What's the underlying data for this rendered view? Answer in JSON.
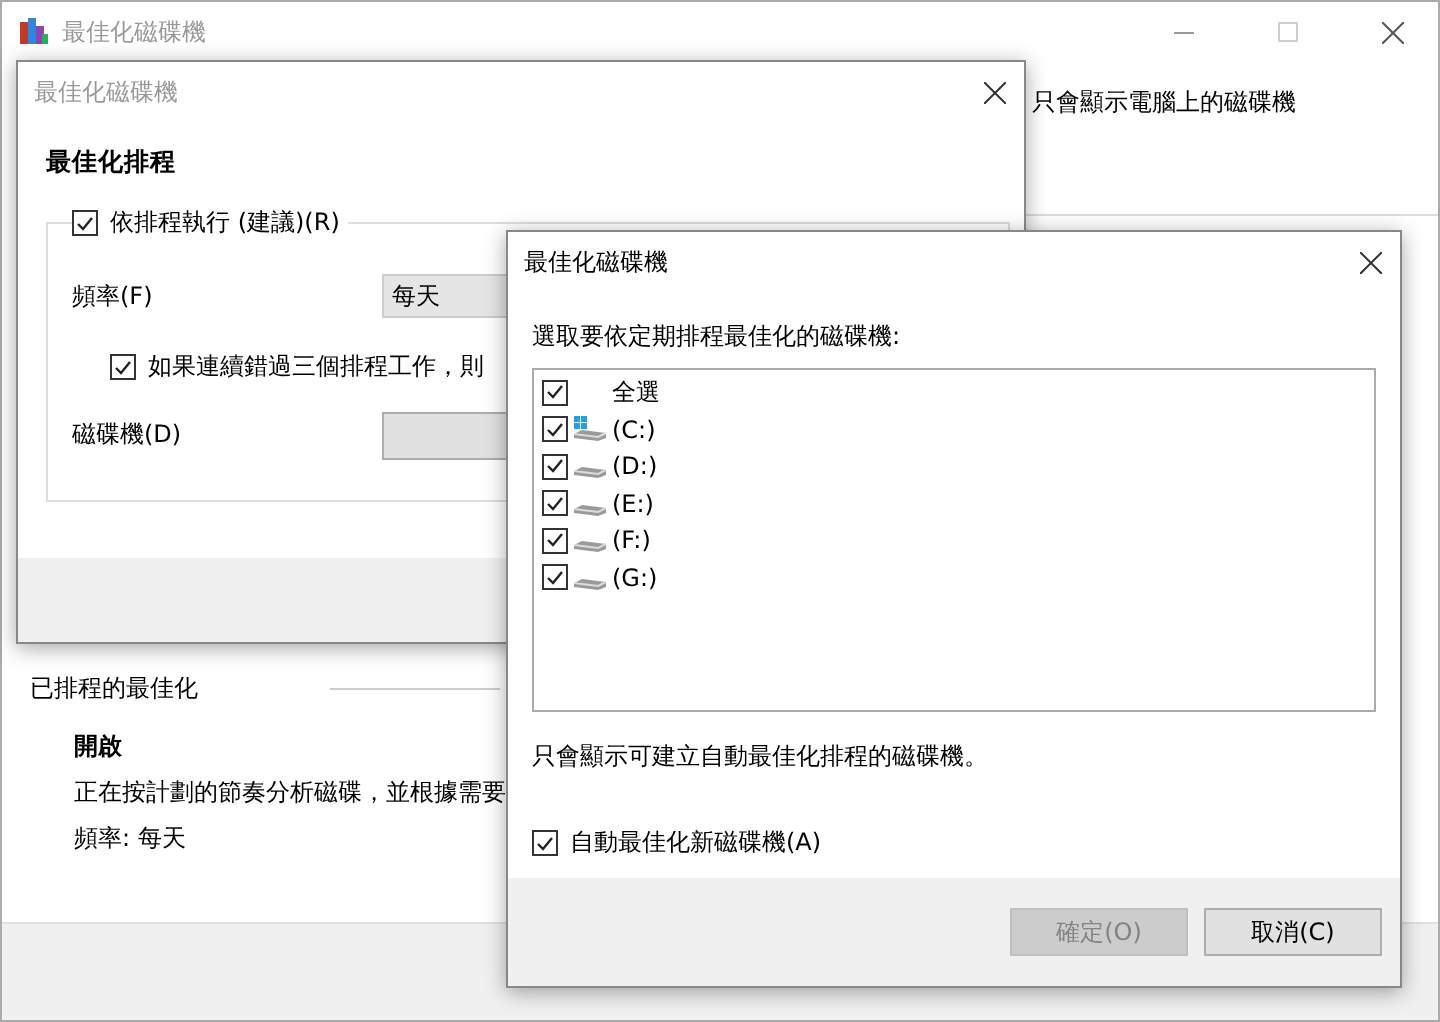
{
  "main_window": {
    "title": "最佳化磁碟機",
    "intro_text": "只會顯示電腦上的磁碟機",
    "scheduled": {
      "heading": "已排程的最佳化",
      "status": "開啟",
      "description": "正在按計劃的節奏分析磁碟，並根據需要",
      "frequency": "頻率: 每天"
    }
  },
  "schedule_dialog": {
    "title": "最佳化磁碟機",
    "heading": "最佳化排程",
    "run_on_schedule": {
      "label": "依排程執行 (建議)(R)",
      "checked": true
    },
    "frequency_label": "頻率(F)",
    "frequency_value": "每天",
    "increase_priority": {
      "label": "如果連續錯過三個排程工作，則",
      "checked": true
    },
    "drives_label": "磁碟機(D)"
  },
  "drive_dialog": {
    "title": "最佳化磁碟機",
    "prompt": "選取要依定期排程最佳化的磁碟機:",
    "items": [
      {
        "kind": "select_all",
        "label": "全選",
        "checked": true
      },
      {
        "kind": "system",
        "label": "(C:)",
        "checked": true
      },
      {
        "kind": "drive",
        "label": "(D:)",
        "checked": true
      },
      {
        "kind": "drive",
        "label": "(E:)",
        "checked": true
      },
      {
        "kind": "drive",
        "label": "(F:)",
        "checked": true
      },
      {
        "kind": "drive",
        "label": "(G:)",
        "checked": true
      }
    ],
    "note": "只會顯示可建立自動最佳化排程的磁碟機。",
    "auto_new": {
      "label": "自動最佳化新磁碟機(A)",
      "checked": true
    },
    "buttons": [
      {
        "label": "確定(O)",
        "disabled": true
      },
      {
        "label": "取消(C)",
        "disabled": false
      }
    ]
  }
}
